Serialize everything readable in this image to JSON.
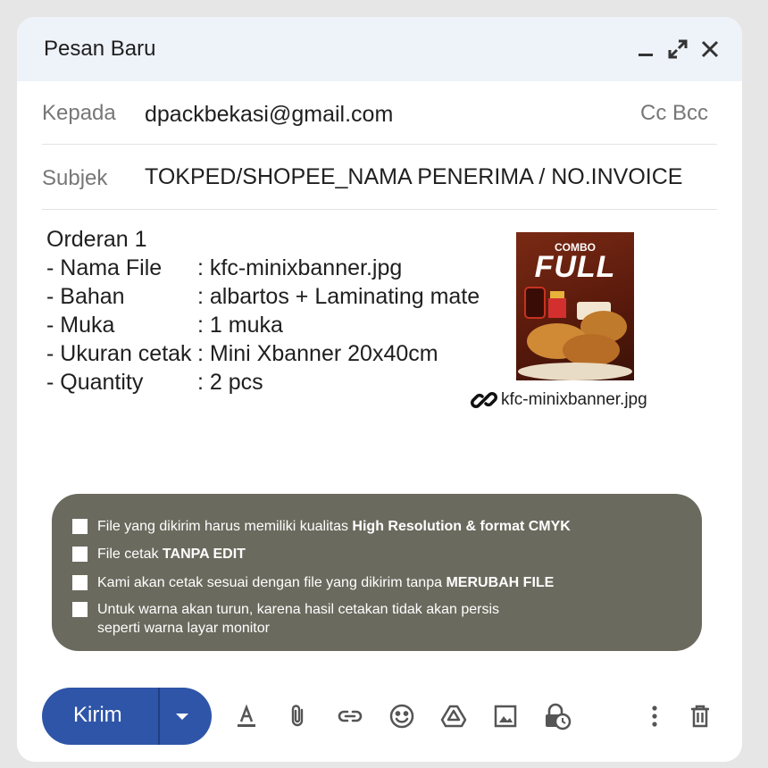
{
  "window": {
    "title": "Pesan Baru"
  },
  "controls": [
    "minimize-icon",
    "expand-icon",
    "close-icon"
  ],
  "to": {
    "label": "Kepada",
    "value": "dpackbekasi@gmail.com",
    "ccbcc": "Cc Bcc"
  },
  "subject": {
    "label": "Subjek",
    "value": "TOKPED/SHOPEE_NAMA PENERIMA / NO.INVOICE"
  },
  "body": {
    "heading": "Orderan 1",
    "rows": [
      {
        "key": "- Nama File",
        "value": ": kfc-minixbanner.jpg"
      },
      {
        "key": "- Bahan",
        "value": ": albartos + Laminating mate"
      },
      {
        "key": "- Muka",
        "value": ": 1 muka"
      },
      {
        "key": "- Ukuran cetak",
        "value": ": Mini Xbanner 20x40cm"
      },
      {
        "key": "- Quantity",
        "value": ": 2 pcs"
      }
    ]
  },
  "attachment": {
    "image_top_text": "COMBO",
    "image_main_text": "FULL",
    "filename": "kfc-minixbanner.jpg"
  },
  "notice": {
    "items": [
      {
        "text": "File yang dikirim harus memiliki kualitas ",
        "bold": "High Resolution & format CMYK"
      },
      {
        "text": "File cetak ",
        "bold": "TANPA EDIT"
      },
      {
        "text": "Kami akan cetak sesuai dengan file yang dikirim tanpa ",
        "bold": "MERUBAH FILE"
      },
      {
        "text": "Untuk warna akan turun, karena hasil cetakan tidak akan persis",
        "text2": "seperti warna layar monitor"
      }
    ]
  },
  "send": {
    "label": "Kirim"
  },
  "toolbar": [
    "format-text-icon",
    "attach-icon",
    "link-icon",
    "emoji-icon",
    "drive-icon",
    "photo-icon",
    "confidential-icon",
    "more-icon",
    "delete-icon"
  ],
  "colors": {
    "send_button": "#2f55a8",
    "notice_bg": "#6b6a5e",
    "titlebar_bg": "#eef2f9"
  }
}
